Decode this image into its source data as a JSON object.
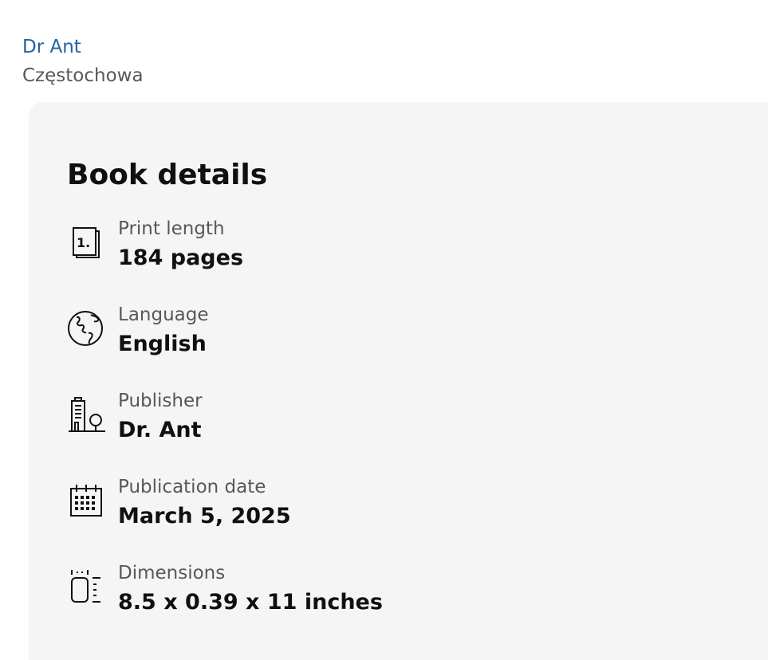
{
  "seller": {
    "name": "Dr Ant",
    "location": "Częstochowa"
  },
  "book_details": {
    "title": "Book details",
    "rows": [
      {
        "icon": "page-number-icon",
        "label": "Print length",
        "value": "184 pages"
      },
      {
        "icon": "globe-icon",
        "label": "Language",
        "value": "English"
      },
      {
        "icon": "building-icon",
        "label": "Publisher",
        "value": "Dr. Ant"
      },
      {
        "icon": "calendar-icon",
        "label": "Publication date",
        "value": "March 5, 2025"
      },
      {
        "icon": "dimensions-icon",
        "label": "Dimensions",
        "value": "8.5 x 0.39 x 11 inches"
      }
    ]
  }
}
